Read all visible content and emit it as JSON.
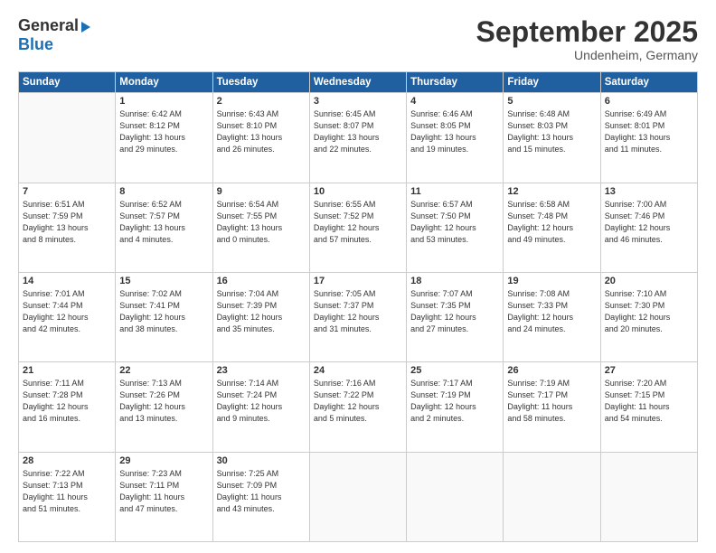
{
  "header": {
    "logo_general": "General",
    "logo_blue": "Blue",
    "month_title": "September 2025",
    "location": "Undenheim, Germany"
  },
  "weekdays": [
    "Sunday",
    "Monday",
    "Tuesday",
    "Wednesday",
    "Thursday",
    "Friday",
    "Saturday"
  ],
  "weeks": [
    [
      {
        "day": "",
        "info": ""
      },
      {
        "day": "1",
        "info": "Sunrise: 6:42 AM\nSunset: 8:12 PM\nDaylight: 13 hours\nand 29 minutes."
      },
      {
        "day": "2",
        "info": "Sunrise: 6:43 AM\nSunset: 8:10 PM\nDaylight: 13 hours\nand 26 minutes."
      },
      {
        "day": "3",
        "info": "Sunrise: 6:45 AM\nSunset: 8:07 PM\nDaylight: 13 hours\nand 22 minutes."
      },
      {
        "day": "4",
        "info": "Sunrise: 6:46 AM\nSunset: 8:05 PM\nDaylight: 13 hours\nand 19 minutes."
      },
      {
        "day": "5",
        "info": "Sunrise: 6:48 AM\nSunset: 8:03 PM\nDaylight: 13 hours\nand 15 minutes."
      },
      {
        "day": "6",
        "info": "Sunrise: 6:49 AM\nSunset: 8:01 PM\nDaylight: 13 hours\nand 11 minutes."
      }
    ],
    [
      {
        "day": "7",
        "info": "Sunrise: 6:51 AM\nSunset: 7:59 PM\nDaylight: 13 hours\nand 8 minutes."
      },
      {
        "day": "8",
        "info": "Sunrise: 6:52 AM\nSunset: 7:57 PM\nDaylight: 13 hours\nand 4 minutes."
      },
      {
        "day": "9",
        "info": "Sunrise: 6:54 AM\nSunset: 7:55 PM\nDaylight: 13 hours\nand 0 minutes."
      },
      {
        "day": "10",
        "info": "Sunrise: 6:55 AM\nSunset: 7:52 PM\nDaylight: 12 hours\nand 57 minutes."
      },
      {
        "day": "11",
        "info": "Sunrise: 6:57 AM\nSunset: 7:50 PM\nDaylight: 12 hours\nand 53 minutes."
      },
      {
        "day": "12",
        "info": "Sunrise: 6:58 AM\nSunset: 7:48 PM\nDaylight: 12 hours\nand 49 minutes."
      },
      {
        "day": "13",
        "info": "Sunrise: 7:00 AM\nSunset: 7:46 PM\nDaylight: 12 hours\nand 46 minutes."
      }
    ],
    [
      {
        "day": "14",
        "info": "Sunrise: 7:01 AM\nSunset: 7:44 PM\nDaylight: 12 hours\nand 42 minutes."
      },
      {
        "day": "15",
        "info": "Sunrise: 7:02 AM\nSunset: 7:41 PM\nDaylight: 12 hours\nand 38 minutes."
      },
      {
        "day": "16",
        "info": "Sunrise: 7:04 AM\nSunset: 7:39 PM\nDaylight: 12 hours\nand 35 minutes."
      },
      {
        "day": "17",
        "info": "Sunrise: 7:05 AM\nSunset: 7:37 PM\nDaylight: 12 hours\nand 31 minutes."
      },
      {
        "day": "18",
        "info": "Sunrise: 7:07 AM\nSunset: 7:35 PM\nDaylight: 12 hours\nand 27 minutes."
      },
      {
        "day": "19",
        "info": "Sunrise: 7:08 AM\nSunset: 7:33 PM\nDaylight: 12 hours\nand 24 minutes."
      },
      {
        "day": "20",
        "info": "Sunrise: 7:10 AM\nSunset: 7:30 PM\nDaylight: 12 hours\nand 20 minutes."
      }
    ],
    [
      {
        "day": "21",
        "info": "Sunrise: 7:11 AM\nSunset: 7:28 PM\nDaylight: 12 hours\nand 16 minutes."
      },
      {
        "day": "22",
        "info": "Sunrise: 7:13 AM\nSunset: 7:26 PM\nDaylight: 12 hours\nand 13 minutes."
      },
      {
        "day": "23",
        "info": "Sunrise: 7:14 AM\nSunset: 7:24 PM\nDaylight: 12 hours\nand 9 minutes."
      },
      {
        "day": "24",
        "info": "Sunrise: 7:16 AM\nSunset: 7:22 PM\nDaylight: 12 hours\nand 5 minutes."
      },
      {
        "day": "25",
        "info": "Sunrise: 7:17 AM\nSunset: 7:19 PM\nDaylight: 12 hours\nand 2 minutes."
      },
      {
        "day": "26",
        "info": "Sunrise: 7:19 AM\nSunset: 7:17 PM\nDaylight: 11 hours\nand 58 minutes."
      },
      {
        "day": "27",
        "info": "Sunrise: 7:20 AM\nSunset: 7:15 PM\nDaylight: 11 hours\nand 54 minutes."
      }
    ],
    [
      {
        "day": "28",
        "info": "Sunrise: 7:22 AM\nSunset: 7:13 PM\nDaylight: 11 hours\nand 51 minutes."
      },
      {
        "day": "29",
        "info": "Sunrise: 7:23 AM\nSunset: 7:11 PM\nDaylight: 11 hours\nand 47 minutes."
      },
      {
        "day": "30",
        "info": "Sunrise: 7:25 AM\nSunset: 7:09 PM\nDaylight: 11 hours\nand 43 minutes."
      },
      {
        "day": "",
        "info": ""
      },
      {
        "day": "",
        "info": ""
      },
      {
        "day": "",
        "info": ""
      },
      {
        "day": "",
        "info": ""
      }
    ]
  ]
}
